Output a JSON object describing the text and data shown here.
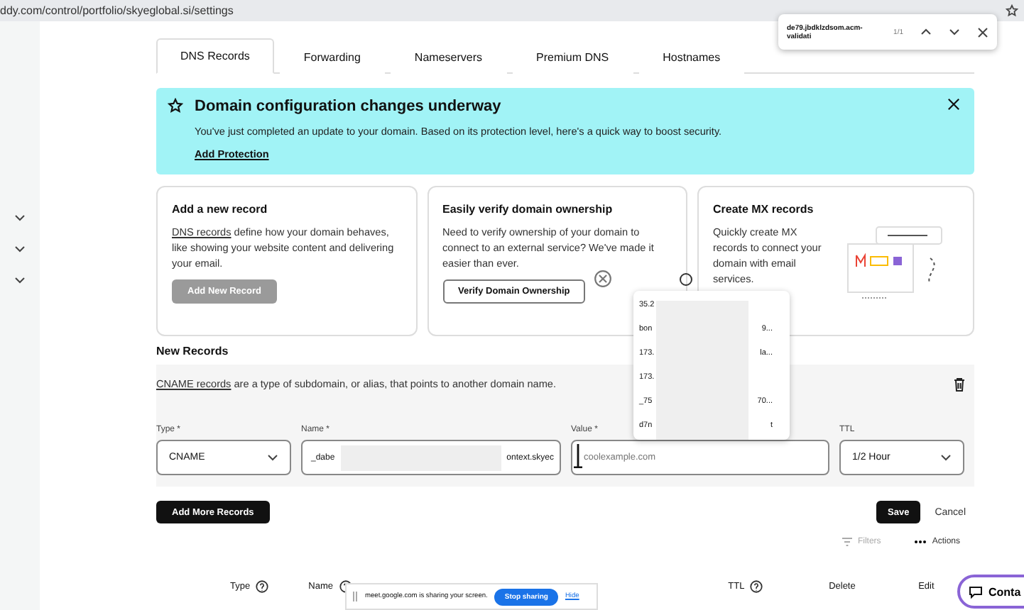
{
  "browser": {
    "url": "ddy.com/control/portfolio/skyeglobal.si/settings",
    "find_query": "de79.jbdklzdsom.acm-validati",
    "find_count": "1/1"
  },
  "tabs": [
    {
      "label": "DNS Records",
      "selected": true
    },
    {
      "label": "Forwarding",
      "selected": false
    },
    {
      "label": "Nameservers",
      "selected": false
    },
    {
      "label": "Premium DNS",
      "selected": false
    },
    {
      "label": "Hostnames",
      "selected": false
    }
  ],
  "banner": {
    "title": "Domain configuration changes underway",
    "body": "You've just completed an update to your domain. Based on its protection level, here's a quick way to boost security.",
    "link": "Add Protection"
  },
  "cards": [
    {
      "kind": "action",
      "title": "Add a new record",
      "link": "DNS records",
      "body": "define how your domain behaves, like showing your website content and delivering your email.",
      "button": "Add New Record",
      "disabled": true
    },
    {
      "kind": "action",
      "title": "Easily verify domain ownership",
      "body": "Need to verify ownership of your domain to connect to an external service? We've made it easier than ever.",
      "button": "Verify Domain Ownership",
      "disabled": false
    },
    {
      "kind": "illustrated",
      "title": "Create MX records",
      "body": "Quickly create MX records to connect your domain with email services."
    }
  ],
  "new_records": {
    "heading": "New Records",
    "link": "CNAME records",
    "text": "are a type of subdomain, or alias, that points to another domain name.",
    "fields": [
      {
        "kind": "select",
        "label": "Type *",
        "value": "CNAME"
      },
      {
        "kind": "redacted",
        "label": "Name *",
        "value_start": "_dabe",
        "value_end": "ontext.skyec"
      },
      {
        "kind": "text",
        "label": "Value *",
        "placeholder": "coolexample.com"
      },
      {
        "kind": "select",
        "label": "TTL",
        "value": "1/2 Hour"
      }
    ]
  },
  "suggestions": [
    {
      "start": "35.2"
    },
    {
      "start": "bon",
      "end": "9..."
    },
    {
      "start": "173.",
      "end": "la..."
    },
    {
      "start": "173."
    },
    {
      "start": "_75",
      "end": "70..."
    },
    {
      "start": "d7n",
      "end": "t"
    }
  ],
  "buttons": {
    "add_more": "Add More Records",
    "save": "Save",
    "cancel": "Cancel"
  },
  "toolbar": {
    "filters": "Filters",
    "actions": "Actions"
  },
  "columns": [
    {
      "label": "Type",
      "help": true
    },
    {
      "label": "Name",
      "help": true
    },
    {
      "label": "TTL",
      "help": true
    },
    {
      "label": "Delete",
      "help": false
    },
    {
      "label": "Edit",
      "help": false
    }
  ],
  "screen_share": {
    "message": "meet.google.com is sharing your screen.",
    "stop": "Stop sharing",
    "hide": "Hide"
  },
  "contact": "Conta"
}
